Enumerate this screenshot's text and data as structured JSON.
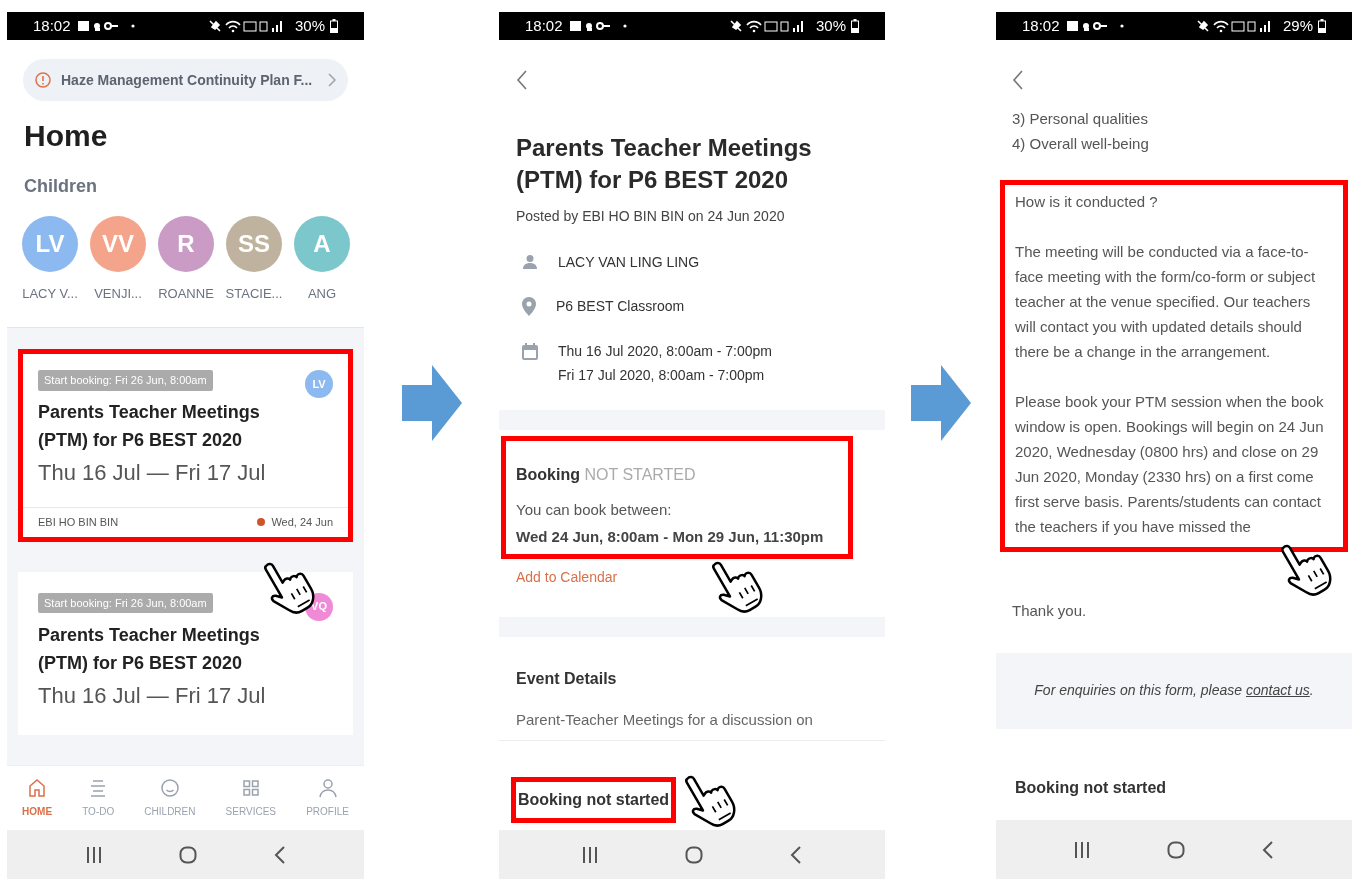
{
  "phones": [
    {
      "kind": "home",
      "status_bar": {
        "time": "18:02",
        "battery": "30%"
      },
      "notice": {
        "text": "Haze Management Continuity Plan F..."
      },
      "title": "Home",
      "children_heading": "Children",
      "children": [
        {
          "initials": "LV",
          "name": "LACY V...",
          "color": "#8cb9ef"
        },
        {
          "initials": "VV",
          "name": "VENJI...",
          "color": "#f4a48a"
        },
        {
          "initials": "R",
          "name": "ROANNE",
          "color": "#c99bc5"
        },
        {
          "initials": "SS",
          "name": "STACIE...",
          "color": "#bfb39f"
        },
        {
          "initials": "A",
          "name": "ANG",
          "color": "#7cc7cb"
        }
      ],
      "cards": [
        {
          "badge": "Start booking: Fri 26 Jun, 8:00am",
          "title": "Parents Teacher Meetings (PTM) for P6 BEST 2020",
          "dates": "Thu 16 Jul — Fri 17 Jul",
          "author": "EBI HO BIN BIN",
          "date": "Wed, 24 Jun",
          "avatar": {
            "initials": "LV",
            "color": "#8cb9ef"
          },
          "highlighted": true,
          "tapped": true
        },
        {
          "badge": "Start booking: Fri 26 Jun, 8:00am",
          "title": "Parents Teacher Meetings (PTM) for P6 BEST 2020",
          "dates": "Thu 16 Jul — Fri 17 Jul",
          "avatar": {
            "initials": "VQ",
            "color": "#f08ad6"
          },
          "highlighted": false,
          "tapped": false
        }
      ],
      "nav": [
        {
          "kind": "home",
          "label": "HOME",
          "selected": true
        },
        {
          "kind": "todo",
          "label": "TO-DO",
          "selected": false
        },
        {
          "kind": "children",
          "label": "CHILDREN",
          "selected": false
        },
        {
          "kind": "services",
          "label": "SERVICES",
          "selected": false
        },
        {
          "kind": "profile",
          "label": "PROFILE",
          "selected": false
        }
      ]
    },
    {
      "kind": "event",
      "status_bar": {
        "time": "18:02",
        "battery": "30%"
      },
      "title": "Parents Teacher Meetings (PTM) for P6 BEST 2020",
      "posted": "Posted by EBI HO BIN BIN on 24 Jun 2020",
      "details": [
        {
          "kind": "person",
          "lines": [
            "LACY VAN LING LING"
          ]
        },
        {
          "kind": "place",
          "lines": [
            "P6 BEST Classroom"
          ]
        },
        {
          "kind": "date",
          "lines": [
            "Thu 16 Jul 2020, 8:00am - 7:00pm",
            "Fri 17 Jul 2020, 8:00am - 7:00pm"
          ]
        }
      ],
      "booking": {
        "heading": "Booking",
        "status": "NOT STARTED",
        "intro": "You can book between:",
        "window": "Wed 24 Jun, 8:00am - Mon 29 Jun, 11:30pm",
        "link": "Add to Calendar",
        "highlighted": true,
        "tapped": true
      },
      "event_details": {
        "heading": "Event Details",
        "text": "Parent-Teacher Meetings for a discussion on"
      },
      "footer": {
        "text": "Booking not started",
        "highlighted": true,
        "tapped": true
      }
    },
    {
      "kind": "details",
      "status_bar": {
        "time": "18:02",
        "battery": "29%"
      },
      "list_lines": [
        "3) Personal qualities",
        "4) Overall well-being"
      ],
      "section": {
        "paragraphs": [
          "How is it conducted ?",
          "The meeting will be conducted via a face-to-face meeting with the form/co-form or subject teacher at the venue specified. Our teachers will contact you with updated details should there be a change in the arrangement.",
          "Please book your PTM session when the book window is open. Bookings will begin on 24 Jun 2020, Wednesday (0800 hrs) and close on 29 Jun 2020, Monday (2330 hrs) on a first come first serve basis. Parents/students can contact the teachers if you have missed the"
        ],
        "highlighted": true,
        "tapped": true
      },
      "closing": "Thank you.",
      "enquiry": {
        "before": "For enquiries on this form, please ",
        "link": "contact us",
        "after": "."
      },
      "footer": {
        "text": "Booking not started",
        "highlighted": false,
        "tapped": false
      }
    }
  ]
}
